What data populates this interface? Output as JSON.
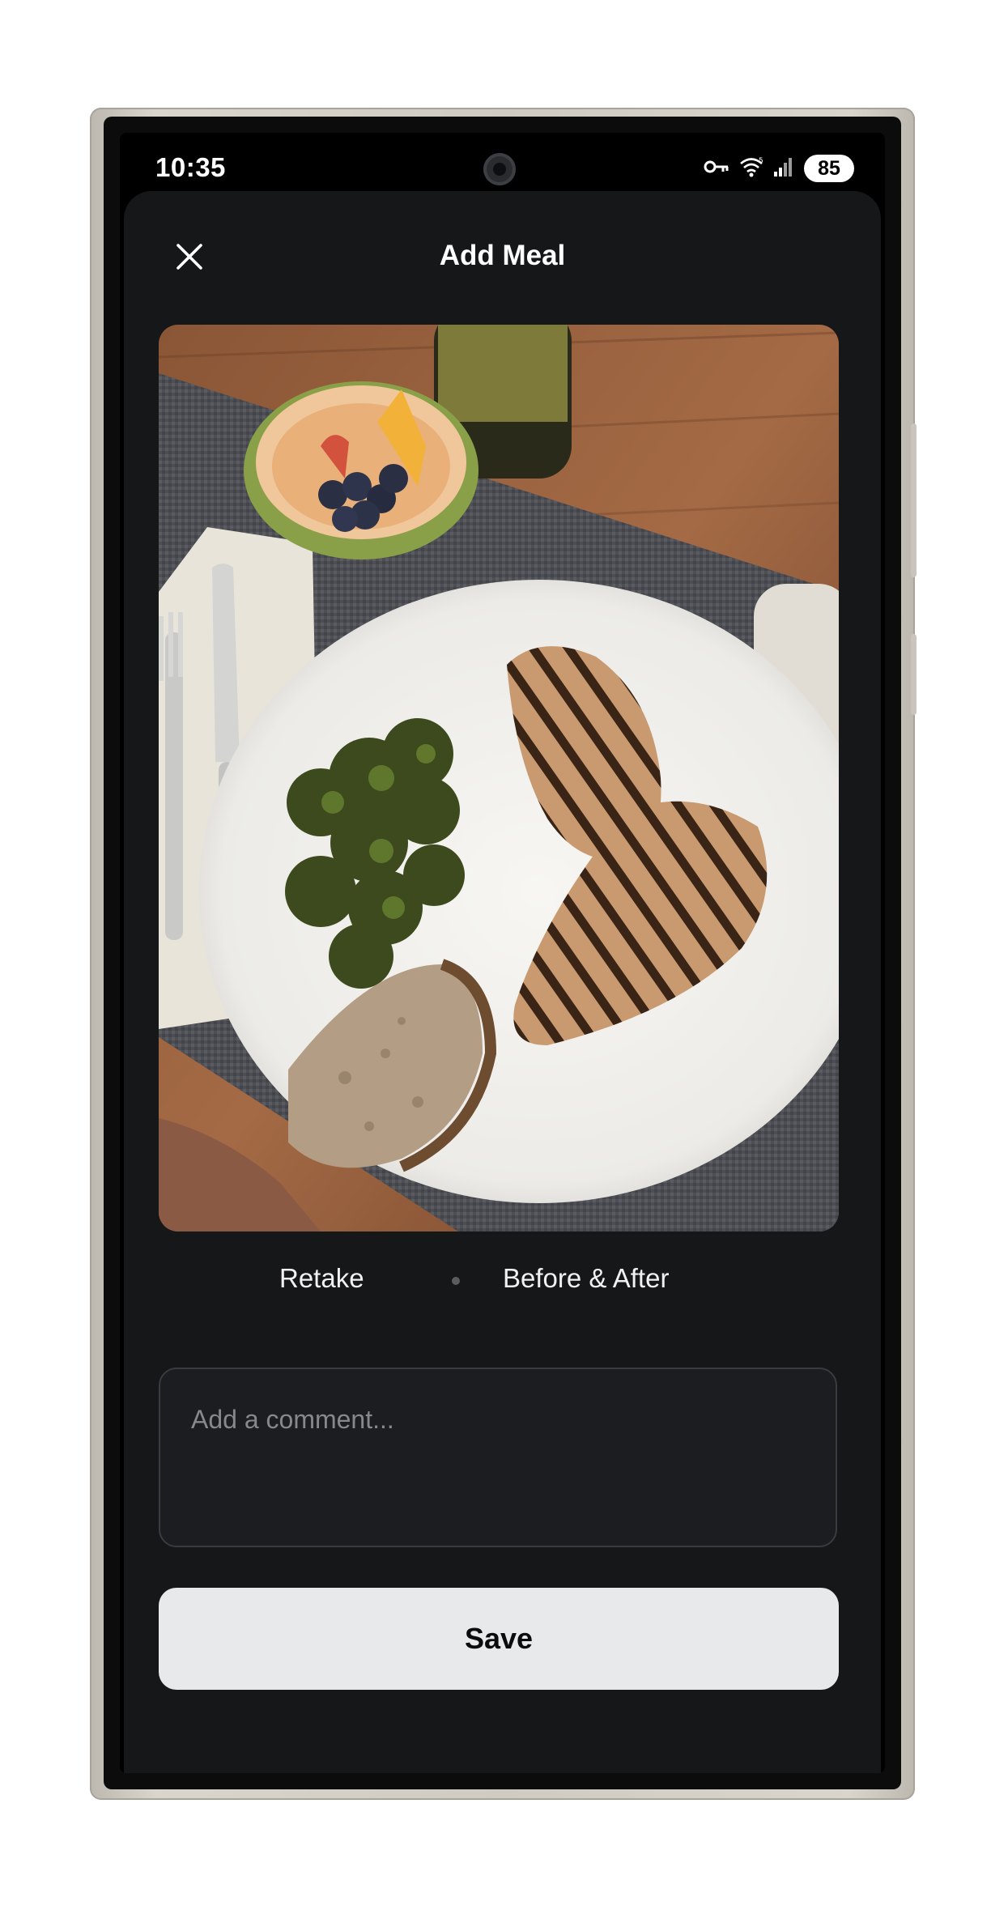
{
  "status_bar": {
    "time": "10:35",
    "battery": "85",
    "icons": [
      "vpn-key-icon",
      "wifi-icon",
      "signal-icon"
    ]
  },
  "header": {
    "title": "Add Meal",
    "close_icon": "close-icon"
  },
  "photo": {
    "description_icon": "meal-photo"
  },
  "photo_actions": {
    "retake": "Retake",
    "before_after": "Before & After"
  },
  "comment": {
    "value": "",
    "placeholder": "Add a comment..."
  },
  "save": {
    "label": "Save"
  },
  "colors": {
    "sheet_background": "#161719",
    "save_button": "#e8e9eb",
    "device_frame": "#cfcbc3"
  }
}
